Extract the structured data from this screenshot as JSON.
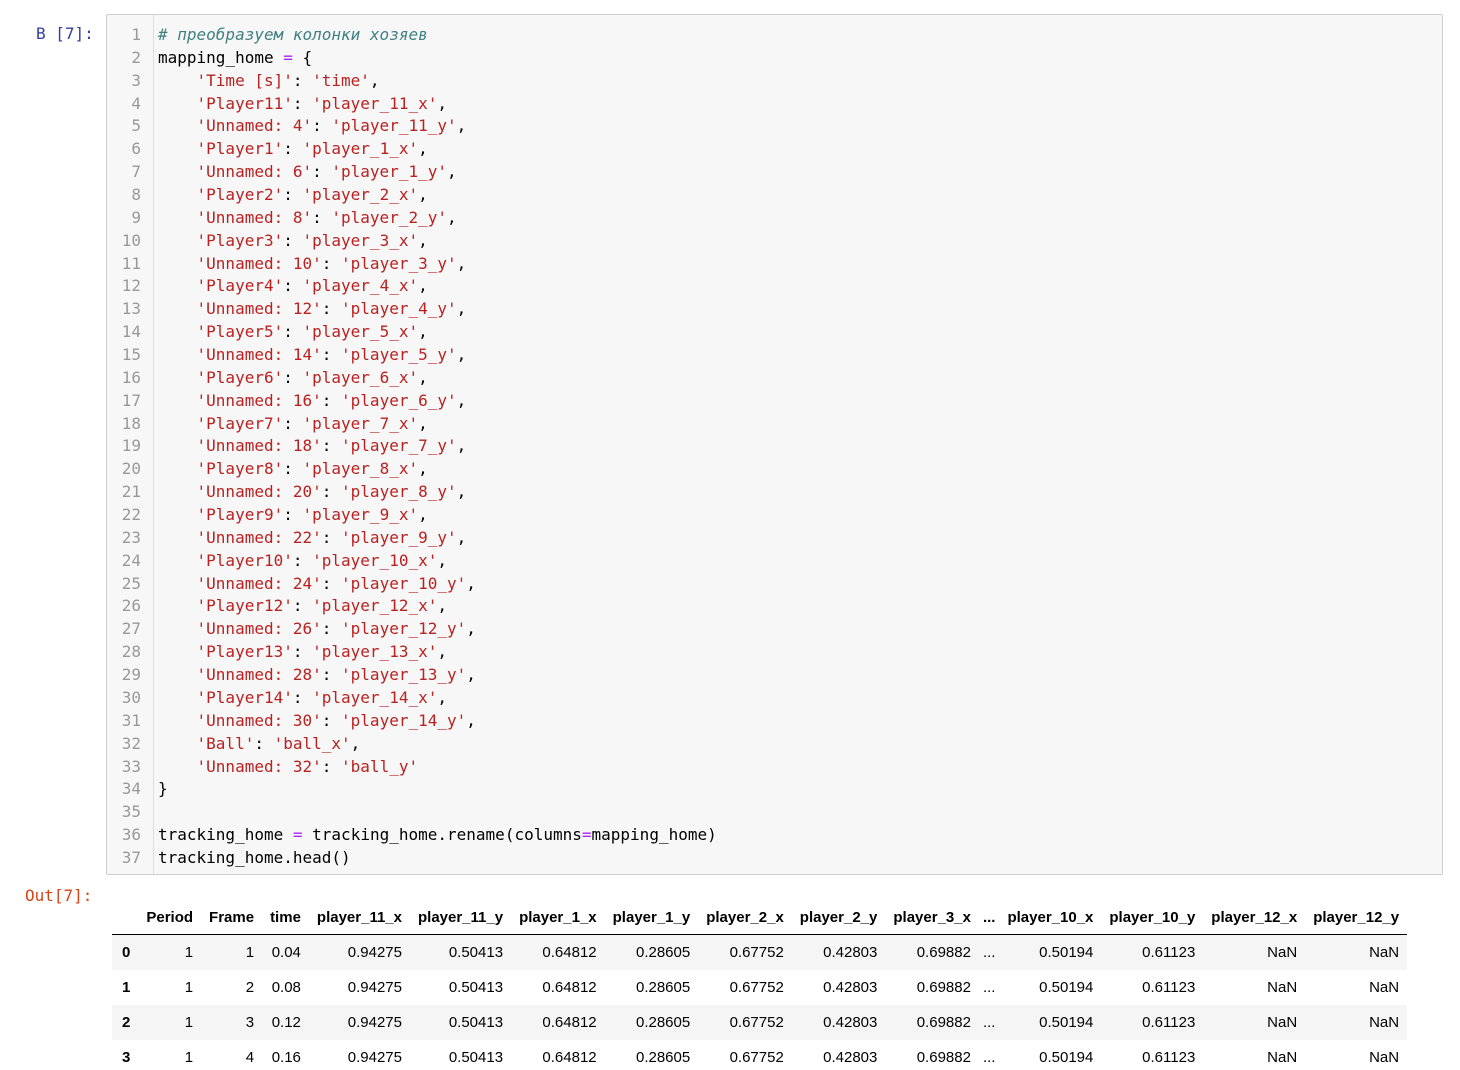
{
  "input_prompt": "В [7]:",
  "output_prompt": "Out[7]:",
  "code": {
    "comment": "# преобразуем колонки хозяев",
    "var": "mapping_home",
    "entries": [
      [
        "'Time [s]'",
        "'time'"
      ],
      [
        "'Player11'",
        "'player_11_x'"
      ],
      [
        "'Unnamed: 4'",
        "'player_11_y'"
      ],
      [
        "'Player1'",
        "'player_1_x'"
      ],
      [
        "'Unnamed: 6'",
        "'player_1_y'"
      ],
      [
        "'Player2'",
        "'player_2_x'"
      ],
      [
        "'Unnamed: 8'",
        "'player_2_y'"
      ],
      [
        "'Player3'",
        "'player_3_x'"
      ],
      [
        "'Unnamed: 10'",
        "'player_3_y'"
      ],
      [
        "'Player4'",
        "'player_4_x'"
      ],
      [
        "'Unnamed: 12'",
        "'player_4_y'"
      ],
      [
        "'Player5'",
        "'player_5_x'"
      ],
      [
        "'Unnamed: 14'",
        "'player_5_y'"
      ],
      [
        "'Player6'",
        "'player_6_x'"
      ],
      [
        "'Unnamed: 16'",
        "'player_6_y'"
      ],
      [
        "'Player7'",
        "'player_7_x'"
      ],
      [
        "'Unnamed: 18'",
        "'player_7_y'"
      ],
      [
        "'Player8'",
        "'player_8_x'"
      ],
      [
        "'Unnamed: 20'",
        "'player_8_y'"
      ],
      [
        "'Player9'",
        "'player_9_x'"
      ],
      [
        "'Unnamed: 22'",
        "'player_9_y'"
      ],
      [
        "'Player10'",
        "'player_10_x'"
      ],
      [
        "'Unnamed: 24'",
        "'player_10_y'"
      ],
      [
        "'Player12'",
        "'player_12_x'"
      ],
      [
        "'Unnamed: 26'",
        "'player_12_y'"
      ],
      [
        "'Player13'",
        "'player_13_x'"
      ],
      [
        "'Unnamed: 28'",
        "'player_13_y'"
      ],
      [
        "'Player14'",
        "'player_14_x'"
      ],
      [
        "'Unnamed: 30'",
        "'player_14_y'"
      ],
      [
        "'Ball'",
        "'ball_x'"
      ],
      [
        "'Unnamed: 32'",
        "'ball_y'"
      ]
    ],
    "line36_lhs": "tracking_home",
    "line36_rhs_pre": "tracking_home.rename(columns",
    "line36_rhs_post": "mapping_home)",
    "line37": "tracking_home.head()"
  },
  "table": {
    "columns": [
      "",
      "Period",
      "Frame",
      "time",
      "player_11_x",
      "player_11_y",
      "player_1_x",
      "player_1_y",
      "player_2_x",
      "player_2_y",
      "player_3_x",
      "...",
      "player_10_x",
      "player_10_y",
      "player_12_x",
      "player_12_y"
    ],
    "rows": [
      [
        "0",
        "1",
        "1",
        "0.04",
        "0.94275",
        "0.50413",
        "0.64812",
        "0.28605",
        "0.67752",
        "0.42803",
        "0.69882",
        "...",
        "0.50194",
        "0.61123",
        "NaN",
        "NaN"
      ],
      [
        "1",
        "1",
        "2",
        "0.08",
        "0.94275",
        "0.50413",
        "0.64812",
        "0.28605",
        "0.67752",
        "0.42803",
        "0.69882",
        "...",
        "0.50194",
        "0.61123",
        "NaN",
        "NaN"
      ],
      [
        "2",
        "1",
        "3",
        "0.12",
        "0.94275",
        "0.50413",
        "0.64812",
        "0.28605",
        "0.67752",
        "0.42803",
        "0.69882",
        "...",
        "0.50194",
        "0.61123",
        "NaN",
        "NaN"
      ],
      [
        "3",
        "1",
        "4",
        "0.16",
        "0.94275",
        "0.50413",
        "0.64812",
        "0.28605",
        "0.67752",
        "0.42803",
        "0.69882",
        "...",
        "0.50194",
        "0.61123",
        "NaN",
        "NaN"
      ]
    ]
  }
}
